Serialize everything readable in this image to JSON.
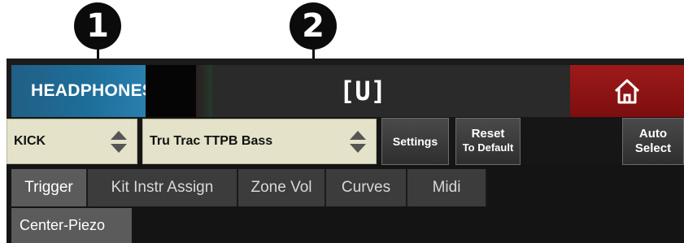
{
  "callouts": [
    "1",
    "2"
  ],
  "header": {
    "device_button": "HEADPHONES",
    "title": "[U]",
    "home_icon": "home-icon",
    "home_color": "#9e1a1a"
  },
  "controls": {
    "instrument_select": "KICK",
    "trigger_select": "Tru Trac TTPB Bass",
    "settings_label": "Settings",
    "reset_line1": "Reset",
    "reset_line2": "To Default",
    "auto_line1": "Auto",
    "auto_line2": "Select"
  },
  "tabs": [
    {
      "label": "Trigger",
      "active": true
    },
    {
      "label": "Kit Instr Assign",
      "active": false
    },
    {
      "label": "Zone Vol",
      "active": false
    },
    {
      "label": "Curves",
      "active": false
    },
    {
      "label": "Midi",
      "active": false
    }
  ],
  "subtab": {
    "label": "Center-Piezo"
  },
  "colors": {
    "select_bg": "#e4e2c8",
    "accent_blue": "#1e6f9b",
    "tab_active": "#5b5b5b"
  }
}
